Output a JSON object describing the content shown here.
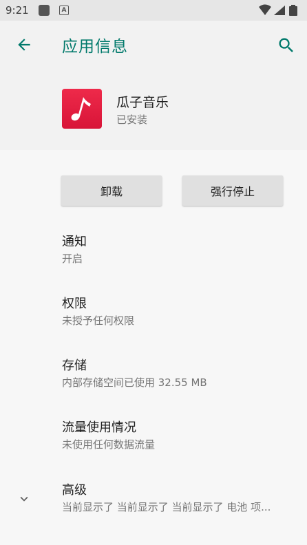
{
  "status_bar": {
    "time": "9:21",
    "icons": [
      "square-notification-icon",
      "a-notification-icon",
      "wifi-icon",
      "signal-icon",
      "battery-icon"
    ]
  },
  "app_bar": {
    "title": "应用信息",
    "back_icon": "arrow-left-icon",
    "search_icon": "search-icon",
    "accent_color": "#00796b"
  },
  "app": {
    "name": "瓜子音乐",
    "status": "已安装",
    "icon": "music-note-icon",
    "icon_color": "#e11e40"
  },
  "actions": {
    "uninstall": "卸载",
    "force_stop": "强行停止"
  },
  "settings": [
    {
      "title": "通知",
      "summary": "开启"
    },
    {
      "title": "权限",
      "summary": "未授予任何权限"
    },
    {
      "title": "存储",
      "summary": "内部存储空间已使用 32.55 MB"
    },
    {
      "title": "流量使用情况",
      "summary": "未使用任何数据流量"
    },
    {
      "title": "高级",
      "summary": "当前显示了 当前显示了 当前显示了 电池 项..."
    }
  ]
}
